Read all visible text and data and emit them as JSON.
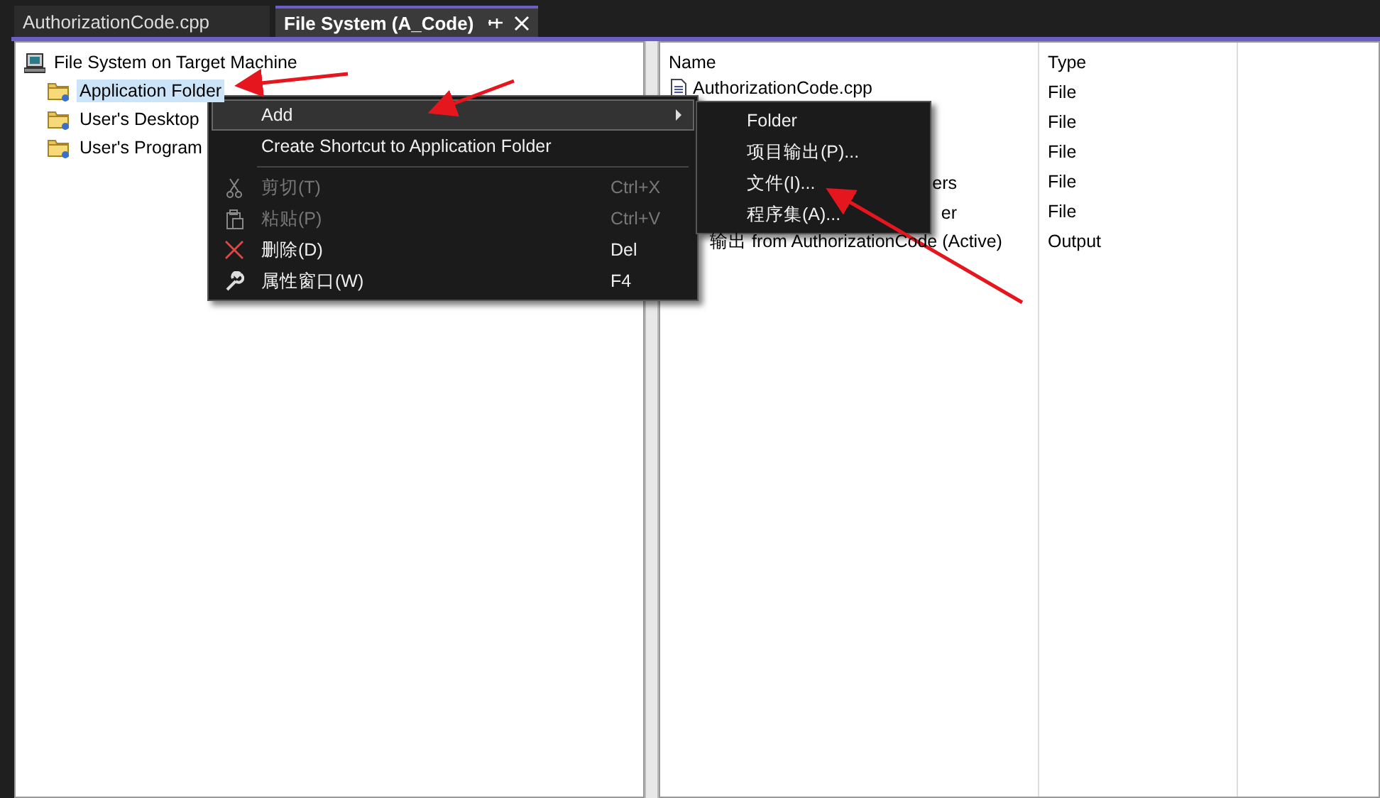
{
  "tabs": [
    {
      "label": "AuthorizationCode.cpp",
      "selected": false
    },
    {
      "label": "File System (A_Code)",
      "selected": true
    }
  ],
  "tree": {
    "root": "File System on Target Machine",
    "children": [
      {
        "label": "Application Folder",
        "selected": true
      },
      {
        "label": "User's Desktop",
        "selected": false
      },
      {
        "label": "User's Program",
        "selected": false
      }
    ]
  },
  "list": {
    "columns": [
      "Name",
      "Type"
    ],
    "rows": [
      {
        "kind": "file",
        "name": "AuthorizationCode.cpp",
        "type": "File"
      },
      {
        "kind": "blank",
        "type": "File"
      },
      {
        "kind": "blank",
        "type": "File"
      },
      {
        "kind": "clipped",
        "name": "ers",
        "type": "File"
      },
      {
        "kind": "clipped",
        "name": "er",
        "type": "File"
      },
      {
        "kind": "text",
        "name": "输出 from AuthorizationCode (Active)",
        "type": "Output"
      }
    ]
  },
  "context_menu": {
    "items": [
      {
        "kind": "submenu",
        "label": "Add",
        "selected": true,
        "disabled": false
      },
      {
        "kind": "plain",
        "label": "Create Shortcut to Application Folder",
        "selected": false,
        "disabled": false
      },
      {
        "kind": "separator"
      },
      {
        "kind": "cut",
        "label": "剪切(T)",
        "shortcut": "Ctrl+X",
        "selected": false,
        "disabled": true
      },
      {
        "kind": "paste",
        "label": "粘贴(P)",
        "shortcut": "Ctrl+V",
        "selected": false,
        "disabled": true
      },
      {
        "kind": "delete",
        "label": "删除(D)",
        "shortcut": "Del",
        "selected": false,
        "disabled": false
      },
      {
        "kind": "properties",
        "label": "属性窗口(W)",
        "shortcut": "F4",
        "selected": false,
        "disabled": false
      }
    ]
  },
  "submenu": {
    "items": [
      {
        "label": "Folder",
        "selected": false
      },
      {
        "label": "项目输出(P)...",
        "selected": false
      },
      {
        "label": "文件(I)...",
        "selected": false
      },
      {
        "label": "程序集(A)...",
        "selected": false
      }
    ]
  }
}
